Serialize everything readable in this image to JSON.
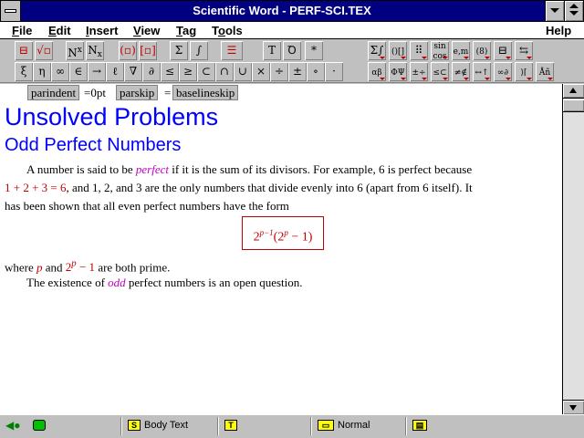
{
  "window": {
    "title": "Scientific Word - PERF-SCI.TEX"
  },
  "menu": {
    "items": [
      {
        "label": "File",
        "hotkey": "F"
      },
      {
        "label": "Edit",
        "hotkey": "E"
      },
      {
        "label": "Insert",
        "hotkey": "I"
      },
      {
        "label": "View",
        "hotkey": "V"
      },
      {
        "label": "Tag",
        "hotkey": "T"
      },
      {
        "label": "Tools",
        "hotkey": "o"
      }
    ],
    "help": "Help"
  },
  "toolbar": {
    "row1": [
      "fraction-icon",
      "radical-icon",
      "superscript-icon",
      "subscript-icon",
      "brackets-icon",
      "matrix-brackets-icon",
      "sum-icon",
      "integral-icon",
      "display-icon",
      "text-icon",
      "math-text-icon",
      "asterisk-icon"
    ],
    "row1_labels": {
      "superscript": "N",
      "superscript_mark": "x",
      "subscript": "N",
      "subscript_mark": "x",
      "sum": "Σ",
      "integral": "∫",
      "text": "T",
      "asterisk": "*"
    },
    "row1_right": [
      {
        "name": "big-operators-icon",
        "label": "Σ∫"
      },
      {
        "name": "brackets-panel-icon",
        "label": "()[]"
      },
      {
        "name": "matrix-panel-icon",
        "label": "⠿"
      },
      {
        "name": "function-panel-icon",
        "label": "sin cos"
      },
      {
        "name": "units-panel-icon",
        "label": "e,m"
      },
      {
        "name": "binomial-panel-icon",
        "label": "(8)"
      },
      {
        "name": "fraction-panel-icon",
        "label": "⊟"
      },
      {
        "name": "arrows-stack-icon",
        "label": "⇆"
      }
    ],
    "row2": [
      "ξ",
      "η",
      "∞",
      "∈",
      "→",
      "ℓ",
      "∇",
      "∂",
      "≤",
      "≥",
      "⊂",
      "∩",
      "∪",
      "×",
      "÷",
      "±",
      "∘",
      "·"
    ],
    "row2_right": [
      {
        "name": "greek-lower-panel-icon",
        "label": "αβ"
      },
      {
        "name": "greek-upper-panel-icon",
        "label": "ΦΨ"
      },
      {
        "name": "binary-ops-panel-icon",
        "label": "±÷"
      },
      {
        "name": "relations-panel-icon",
        "label": "≤⊂"
      },
      {
        "name": "negated-relations-panel-icon",
        "label": "≠∉"
      },
      {
        "name": "arrows-panel-icon",
        "label": "↔↑"
      },
      {
        "name": "misc-symbols-panel-icon",
        "label": "∞∂"
      },
      {
        "name": "delimiters-panel-icon",
        "label": "⟩⌈"
      },
      {
        "name": "accents-panel-icon",
        "label": "Åñ"
      }
    ]
  },
  "tags": {
    "parindent": "parindent",
    "parindent_value": "=0pt",
    "parskip": "parskip",
    "equals": "=",
    "baselineskip": "baselineskip"
  },
  "document": {
    "title": "Unsolved Problems",
    "subtitle": "Odd Perfect Numbers",
    "p1_a": "A number is said to be ",
    "p1_perfect": "perfect",
    "p1_b": " if it is the sum of its divisors. For example, 6 is perfect because",
    "p2_math": "1 + 2 + 3 = 6",
    "p2_text": ", and 1, 2, and 3 are the only numbers that divide evenly into 6 (apart from 6 itself). It",
    "p3_text": "has been shown that all even perfect numbers have the form",
    "display_base": "2",
    "display_exp": "p−1",
    "display_paren_open": "(2",
    "display_paren_exp": "p",
    "display_paren_rest": " − 1)",
    "p4_a": "where ",
    "p4_p": "p",
    "p4_b": " and ",
    "p4_two": "2",
    "p4_exp": "p",
    "p4_minus": " − 1",
    "p4_c": " are both prime.",
    "p5_a": "The existence of ",
    "p5_odd": "odd",
    "p5_b": " perfect numbers is an open question."
  },
  "status": {
    "section_tag": "Body Text",
    "item_tag": "",
    "paragraph_tag": "Normal"
  }
}
